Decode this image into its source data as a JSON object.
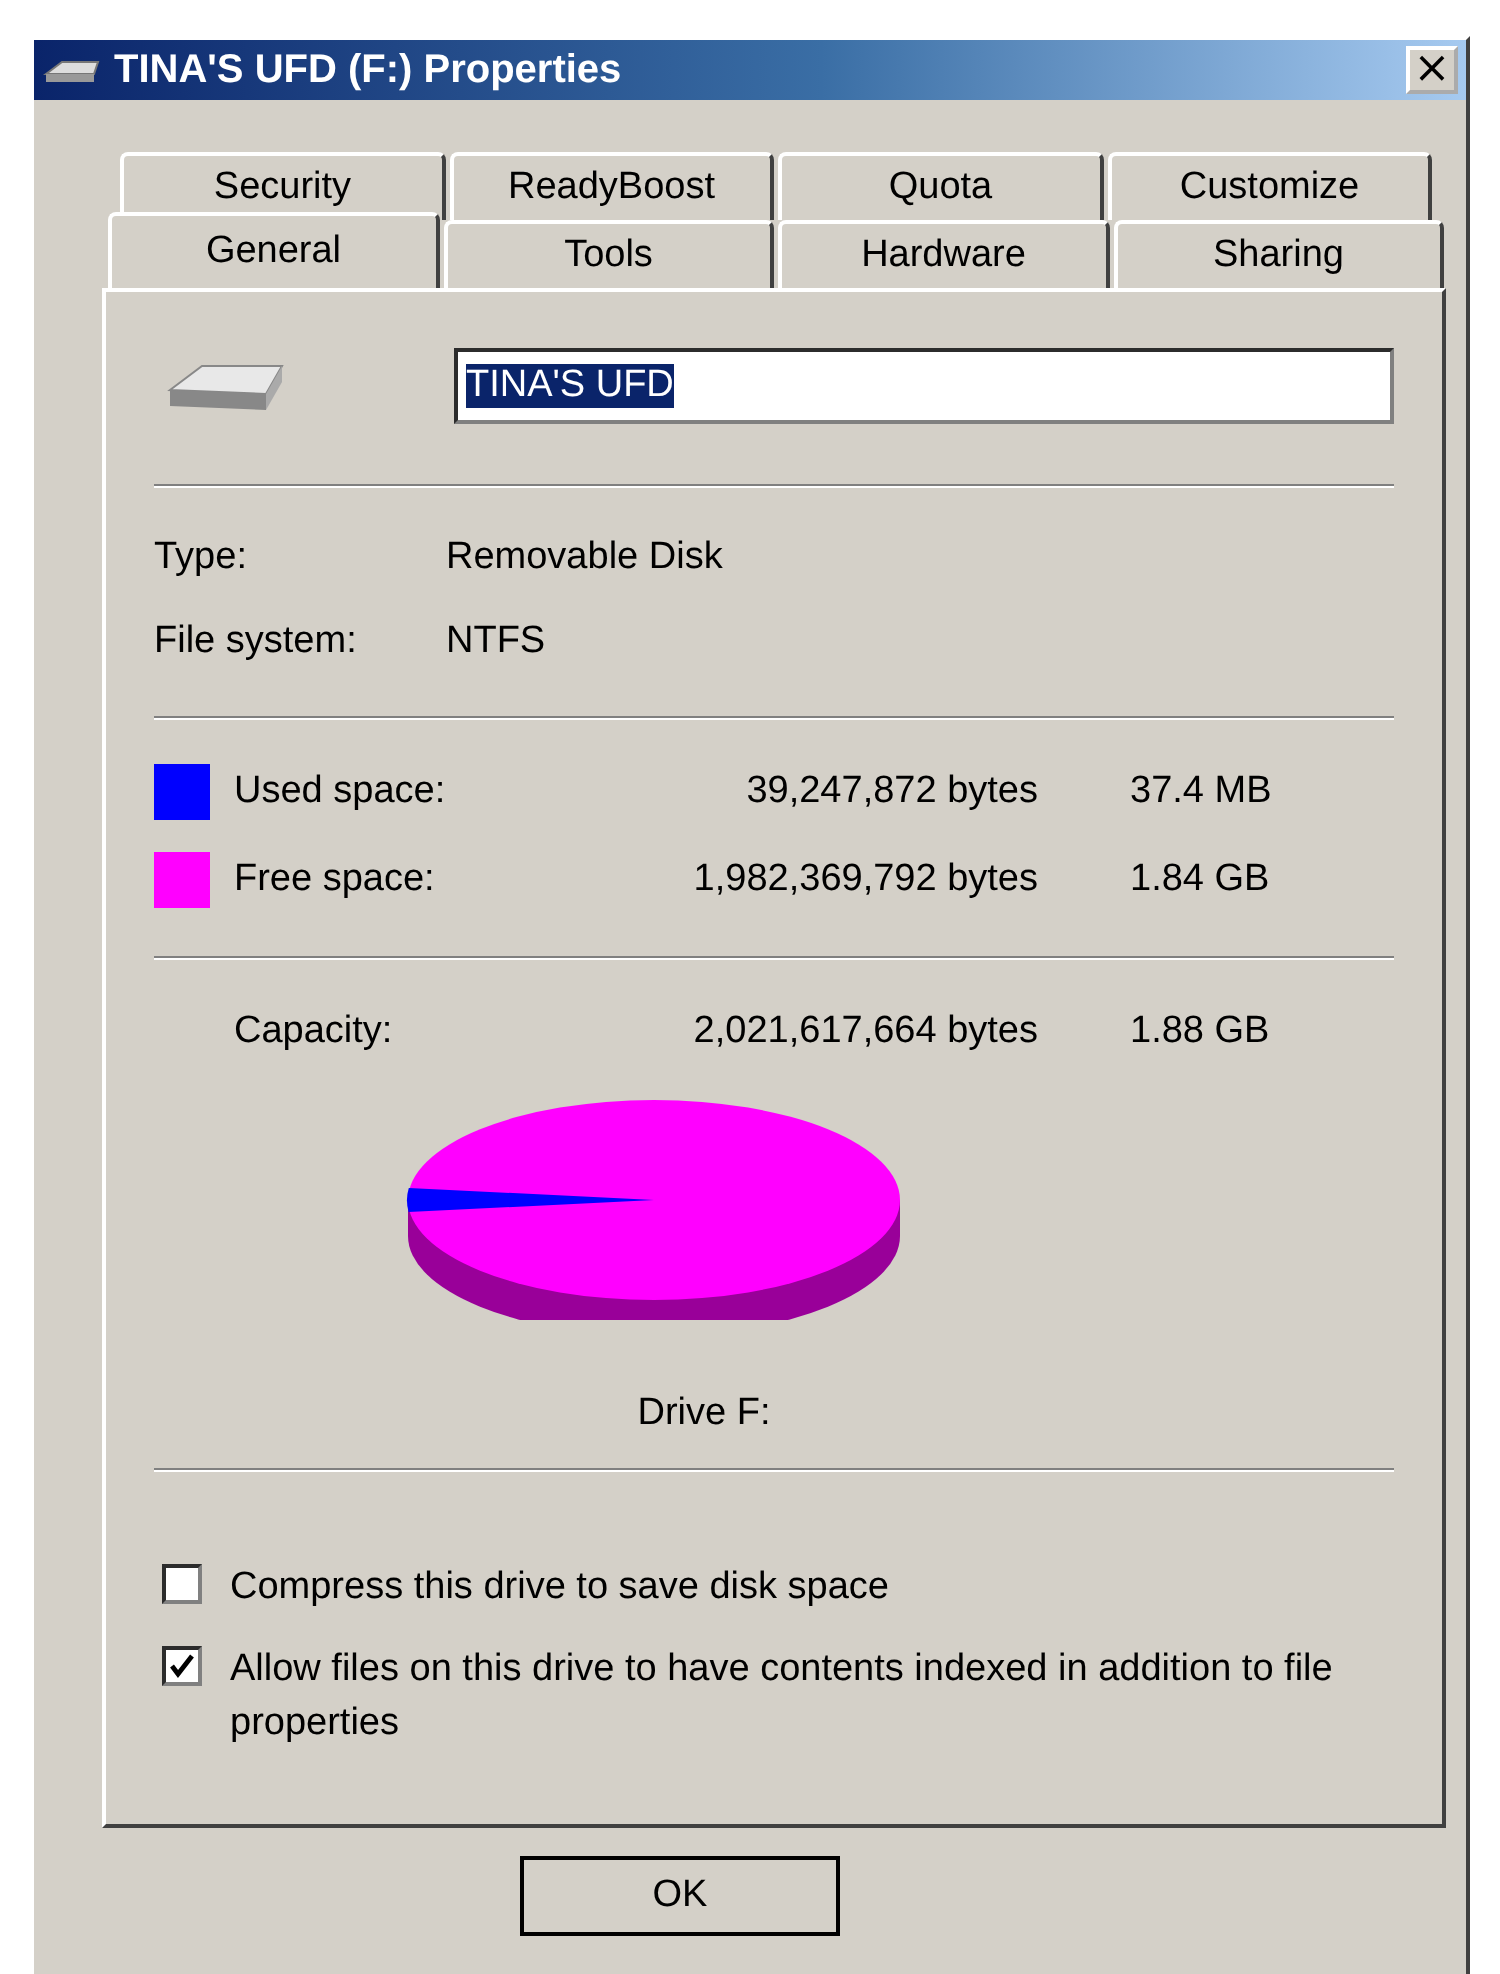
{
  "window": {
    "title": "TINA'S UFD (F:) Properties",
    "close": "×"
  },
  "tab_rows": [
    {
      "tabs": [
        {
          "label": "Security",
          "selected": false
        },
        {
          "label": "ReadyBoost",
          "selected": false
        },
        {
          "label": "Quota",
          "selected": false
        },
        {
          "label": "Customize",
          "selected": false
        }
      ]
    },
    {
      "tabs": [
        {
          "label": "General",
          "selected": true
        },
        {
          "label": "Tools",
          "selected": false
        },
        {
          "label": "Hardware",
          "selected": false
        },
        {
          "label": "Sharing",
          "selected": false
        }
      ]
    }
  ],
  "name_field": {
    "value": "TINA'S UFD"
  },
  "info": [
    {
      "label": "Type:",
      "value": "Removable Disk"
    },
    {
      "label": "File system:",
      "value": "NTFS"
    }
  ],
  "space": [
    {
      "label": "Used space:",
      "bytes": "39,247,872 bytes",
      "size": "37.4 MB",
      "color": "#0000ff"
    },
    {
      "label": "Free space:",
      "bytes": "1,982,369,792 bytes",
      "size": "1.84 GB",
      "color": "#ff00ff"
    }
  ],
  "capacity": {
    "label": "Capacity:",
    "bytes": "2,021,617,664 bytes",
    "size": "1.88 GB"
  },
  "drive_label": "Drive F:",
  "options": [
    {
      "label": "Compress this drive to save disk space",
      "checked": false
    },
    {
      "label": "Allow files on this drive to have contents indexed in addition to file properties",
      "checked": true
    }
  ],
  "buttons": [
    "OK"
  ]
}
